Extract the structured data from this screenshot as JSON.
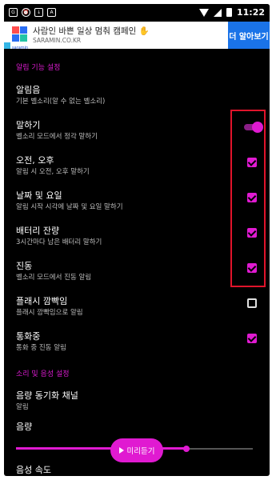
{
  "status_bar": {
    "left_icons": [
      "gps-icon",
      "alarm-icon",
      "download-icon",
      "app-icon"
    ],
    "time": "11:22"
  },
  "ad": {
    "logo_text": "saramin",
    "title": "사람인 바쁜 일상 멈춰 캠페인 ✋",
    "url": "SARAMIN.CO.KR",
    "cta": "더 알아보기"
  },
  "sections": {
    "alarm_header": "알림 기능 설정",
    "sound_header": "소리 및 음성 설정"
  },
  "items": {
    "ringtone": {
      "title": "알림음",
      "subtitle": "기본 벨소리(알 수 없는 벨소리)"
    },
    "speak": {
      "title": "말하기",
      "subtitle": "벨소리 모드에서 정각 말하기",
      "enabled": true
    },
    "ampm": {
      "title": "오전, 오후",
      "subtitle": "알림 시 오전, 오후 말하기",
      "checked": true
    },
    "date": {
      "title": "날짜 및 요일",
      "subtitle": "알림 시작 시각에 날짜 및 요일 말하기",
      "checked": true
    },
    "battery": {
      "title": "배터리 잔량",
      "subtitle": "3시간마다 남은 배터리 말하기",
      "checked": true
    },
    "vibrate": {
      "title": "진동",
      "subtitle": "벨소리 모드에서 진동 알림",
      "checked": true
    },
    "flash": {
      "title": "플래시 깜빡임",
      "subtitle": "플래시 깜빡임으로 알림",
      "checked": false
    },
    "call": {
      "title": "통화중",
      "subtitle": "통화 중 진동 알림",
      "checked": true
    },
    "voice_sync": {
      "title": "음량 동기화 채널",
      "subtitle": "알림"
    },
    "volume": {
      "title": "음량",
      "level": 0.72
    },
    "speed": {
      "title": "음성 속도"
    }
  },
  "preview_button": "미리듣기",
  "colors": {
    "accent": "#e01ad1",
    "highlight_box": "#e0142b",
    "background": "#000000"
  }
}
